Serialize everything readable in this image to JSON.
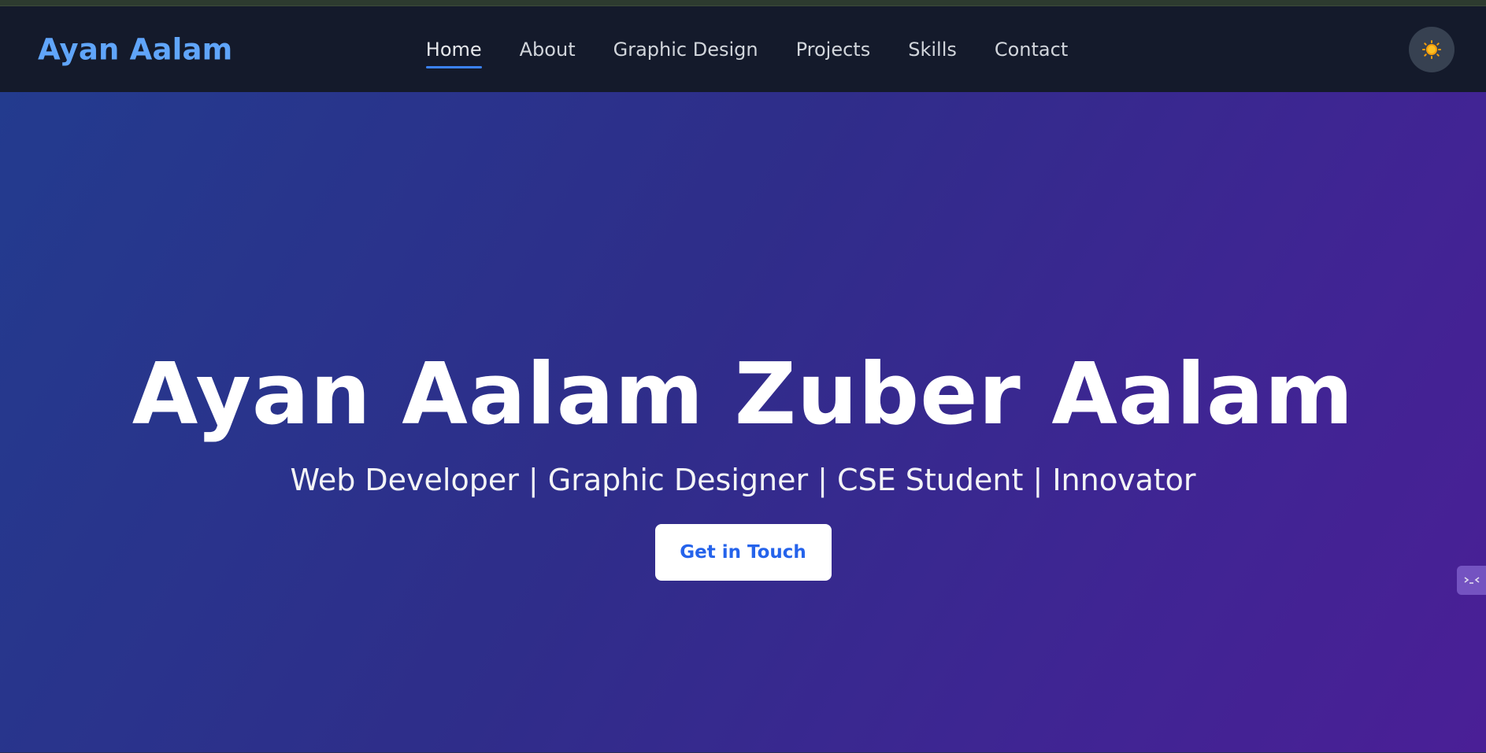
{
  "brand": {
    "name": "Ayan Aalam"
  },
  "nav": {
    "items": [
      {
        "label": "Home",
        "active": true
      },
      {
        "label": "About",
        "active": false
      },
      {
        "label": "Graphic Design",
        "active": false
      },
      {
        "label": "Projects",
        "active": false
      },
      {
        "label": "Skills",
        "active": false
      },
      {
        "label": "Contact",
        "active": false
      }
    ],
    "theme_toggle_icon": "sun-icon"
  },
  "hero": {
    "title": "Ayan Aalam Zuber Aalam",
    "subtitle": "Web Developer | Graphic Designer | CSE Student | Innovator",
    "cta_label": "Get in Touch"
  },
  "side_widget": {
    "icon": "terminal-icon"
  },
  "colors": {
    "navbar_bg": "#141a2b",
    "brand": "#60a5fa",
    "accent": "#3b82f6",
    "hero_gradient_start": "#233b8e",
    "hero_gradient_end": "#4a1f96",
    "cta_text": "#2563eb"
  }
}
